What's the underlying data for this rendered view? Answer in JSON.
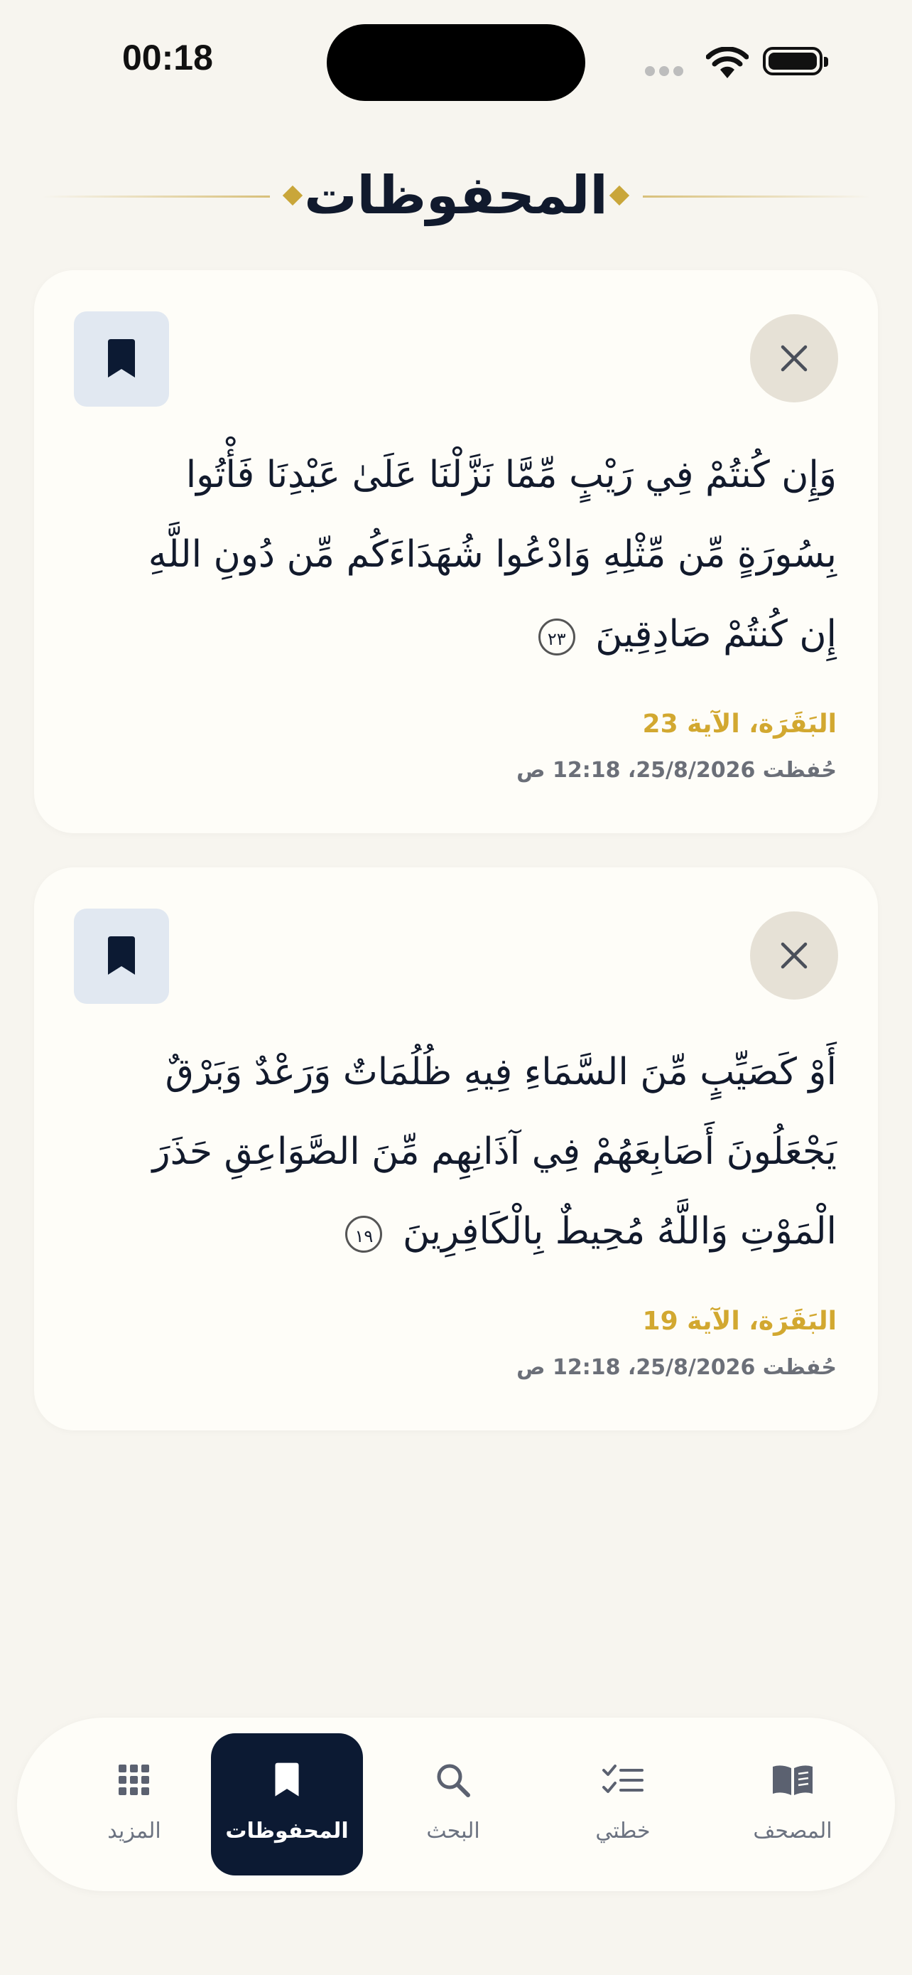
{
  "status": {
    "time": "00:18"
  },
  "header": {
    "title": "المحفوظات"
  },
  "bookmarks": [
    {
      "verse": "وَإِن كُنتُمْ فِي رَيْبٍ مِّمَّا نَزَّلْنَا عَلَىٰ عَبْدِنَا فَأْتُوا بِسُورَةٍ مِّن مِّثْلِهِ وَادْعُوا شُهَدَاءَكُم مِّن دُونِ اللَّهِ إِن كُنتُمْ صَادِقِينَ",
      "ayah_number": "٢٣",
      "reference": "البَقَرَة، الآية 23",
      "saved": "حُفظت 25/8/2026، 12:18 ص"
    },
    {
      "verse": "أَوْ كَصَيِّبٍ مِّنَ السَّمَاءِ فِيهِ ظُلُمَاتٌ وَرَعْدٌ وَبَرْقٌ يَجْعَلُونَ أَصَابِعَهُمْ فِي آذَانِهِم مِّنَ الصَّوَاعِقِ حَذَرَ الْمَوْتِ وَاللَّهُ مُحِيطٌ بِالْكَافِرِينَ",
      "ayah_number": "١٩",
      "reference": "البَقَرَة، الآية 19",
      "saved": "حُفظت 25/8/2026، 12:18 ص"
    }
  ],
  "tabs": [
    {
      "label": "المزيد",
      "icon": "grid-icon"
    },
    {
      "label": "المحفوظات",
      "icon": "bookmark-icon",
      "active": true
    },
    {
      "label": "البحث",
      "icon": "search-icon"
    },
    {
      "label": "خطتي",
      "icon": "checklist-icon"
    },
    {
      "label": "المصحف",
      "icon": "book-icon"
    }
  ],
  "colors": {
    "background": "#f7f5ef",
    "card": "#fefdf8",
    "accent_gold": "#d2a830",
    "navy": "#0c1a33"
  }
}
